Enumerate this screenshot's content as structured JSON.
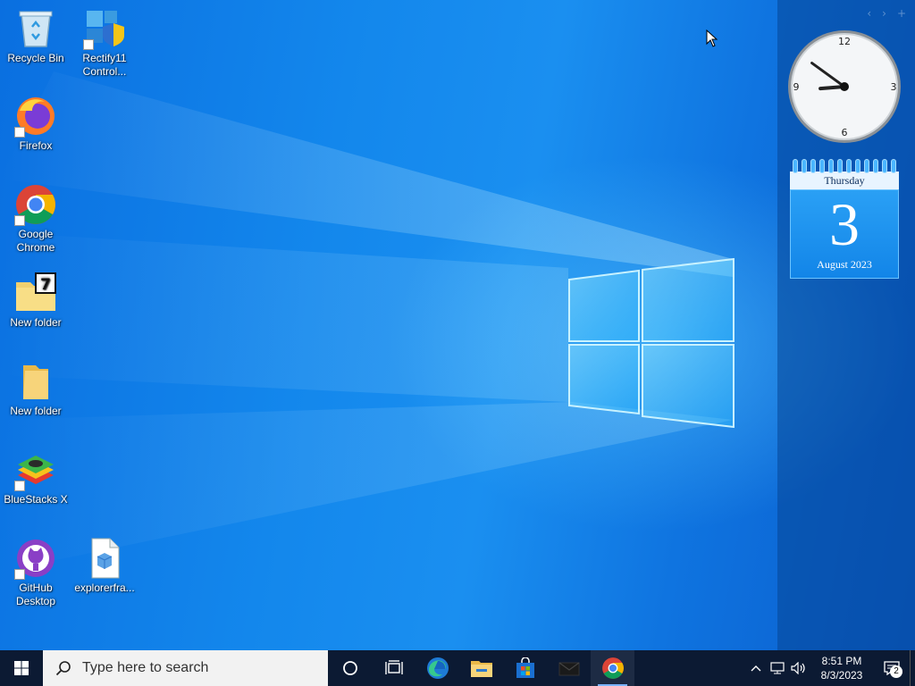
{
  "desktop": {
    "icons": [
      {
        "label": "Recycle Bin",
        "icon": "recycle-bin-icon"
      },
      {
        "label": "Rectify11 Control...",
        "icon": "control-panel-icon"
      },
      {
        "label": "Firefox",
        "icon": "firefox-icon"
      },
      {
        "label": "Google Chrome",
        "icon": "chrome-icon"
      },
      {
        "label": "New folder",
        "icon": "folder-7zip-icon"
      },
      {
        "label": "New folder",
        "icon": "folder-icon"
      },
      {
        "label": "BlueStacks X",
        "icon": "bluestacks-icon"
      },
      {
        "label": "GitHub Desktop",
        "icon": "github-desktop-icon"
      },
      {
        "label": "explorerfra...",
        "icon": "file-icon"
      }
    ]
  },
  "gadgets": {
    "clock": {
      "numbers": [
        "12",
        "3",
        "6",
        "9"
      ],
      "hour": 8,
      "minute": 51
    },
    "calendar": {
      "weekday": "Thursday",
      "day": "3",
      "month_year": "August 2023"
    },
    "nav": [
      "‹",
      "›",
      "+"
    ]
  },
  "taskbar": {
    "search_placeholder": "Type here to search",
    "apps": [
      "cortana-icon",
      "task-view-icon",
      "edge-icon",
      "file-explorer-icon",
      "store-icon",
      "mail-icon",
      "chrome-icon"
    ],
    "active_app": "chrome-icon",
    "tray": {
      "time": "8:51 PM",
      "date": "8/3/2023",
      "notification_count": "2"
    }
  },
  "colors": {
    "taskbar": "#0c1a33",
    "accent": "#1a8ff0"
  }
}
